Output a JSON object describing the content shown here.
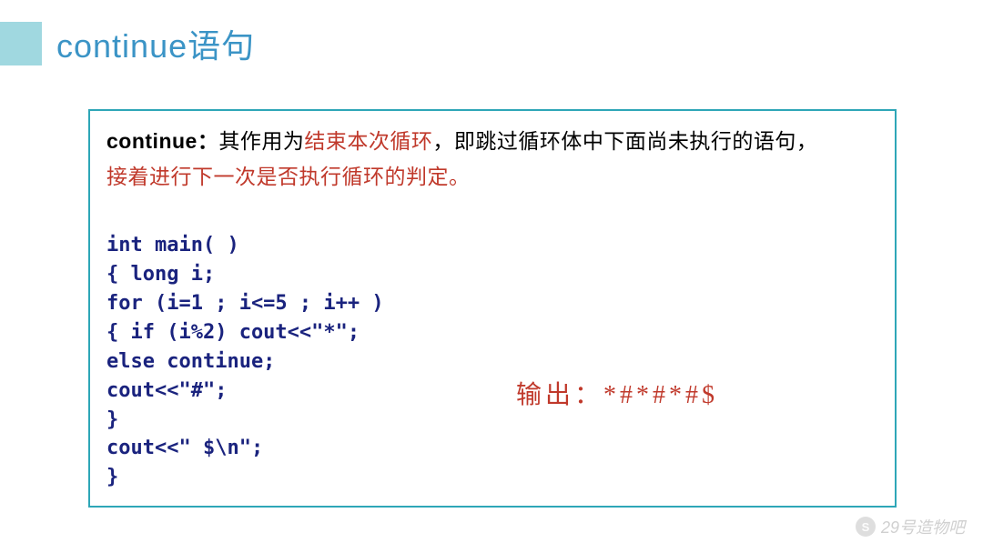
{
  "header": {
    "title": "continue语句"
  },
  "description": {
    "prefix_bold": "continue：",
    "part1": "其作用为",
    "red1": "结束本次循环",
    "part2": "，即跳过循环体中下面尚未执行的语句，",
    "red2": "接着进行下一次是否执行循环的判定。"
  },
  "code": {
    "l1": "int main( )",
    "l2": "{    long   i;",
    "l3": "      for (i=1 ; i<=5 ; i++ )",
    "l4": "        { if (i%2)   cout<<\"*\";",
    "l5": "                  else   continue;",
    "l6": "           cout<<\"#\";",
    "l7": "         }",
    "l8": "   cout<<\" $\\n\";",
    "l9": "   }"
  },
  "output": {
    "label": "输出：",
    "value": "*#*#*#$"
  },
  "watermark": {
    "icon_glyph": "S",
    "text": "29号造物吧"
  }
}
